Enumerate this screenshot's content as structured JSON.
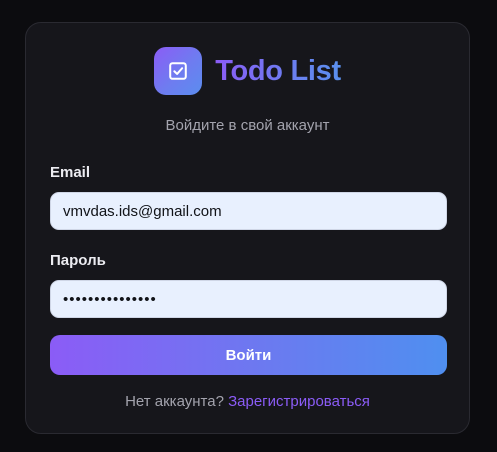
{
  "brand": {
    "title": "Todo List",
    "logo_icon": "checkbox-check-icon",
    "accent_start": "#8b5cf6",
    "accent_end": "#4f8ff0"
  },
  "login": {
    "subtitle": "Войдите в свой аккаунт",
    "email": {
      "label": "Email",
      "value": "vmvdas.ids@gmail.com"
    },
    "password": {
      "label": "Пароль",
      "value": "•••••••••••••••"
    },
    "submit_label": "Войти",
    "footer": {
      "prompt": "Нет аккаунта?",
      "link": "Зарегистрироваться"
    }
  }
}
